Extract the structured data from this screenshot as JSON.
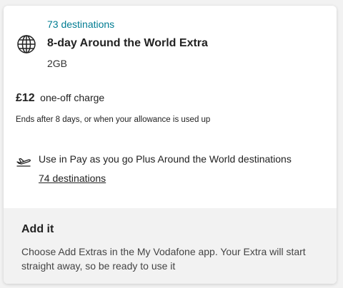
{
  "extra": {
    "destinations_count": "73 destinations",
    "icon": "globe-icon",
    "name": "8-day Around the World Extra",
    "allowance": "2GB",
    "price_amount": "£12",
    "price_label": "one-off charge",
    "ends_text": "Ends after 8 days, or when your allowance is used up"
  },
  "payg": {
    "icon": "plane-takeoff-icon",
    "text": "Use in Pay as you go Plus Around the World destinations",
    "link_label": "74 destinations"
  },
  "add_it": {
    "title": "Add it",
    "body": "Choose Add Extras in the My Vodafone app. Your Extra will start straight away, so be ready to use it"
  },
  "colors": {
    "accent_teal": "#007c92",
    "panel_grey": "#f2f2f2"
  }
}
